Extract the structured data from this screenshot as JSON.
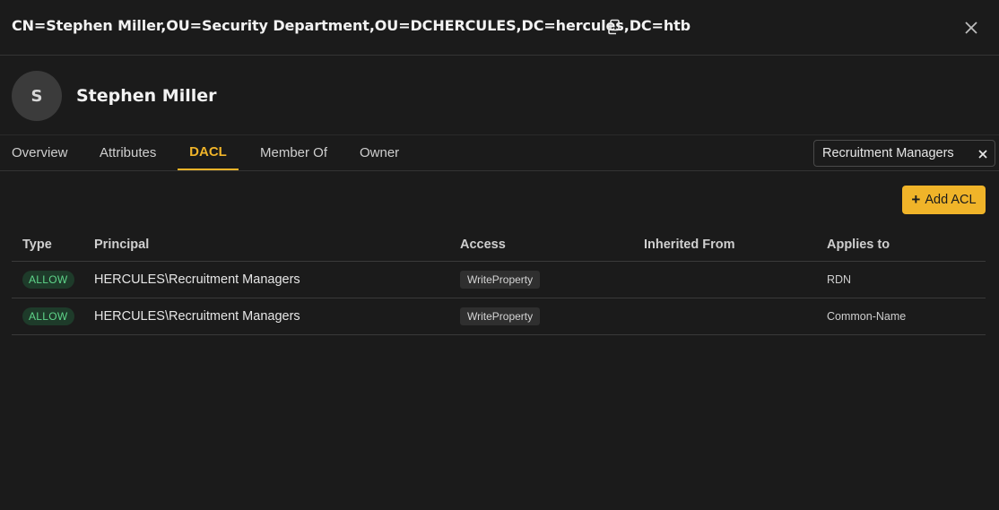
{
  "dialog": {
    "title": "CN=Stephen Miller,OU=Security Department,OU=DCHERCULES,DC=hercules,DC=htb",
    "copy_icon": "copy-icon",
    "close_icon": "close-icon"
  },
  "profile": {
    "avatar_initial": "S",
    "name": "Stephen Miller"
  },
  "tabs": [
    {
      "label": "Overview"
    },
    {
      "label": "Attributes"
    },
    {
      "label": "DACL",
      "active": true
    },
    {
      "label": "Member Of"
    },
    {
      "label": "Owner"
    }
  ],
  "filter": {
    "value": "Recruitment Managers",
    "clear_icon": "close-icon"
  },
  "actions": {
    "add_acl_label": "Add ACL",
    "add_icon": "plus-icon"
  },
  "table": {
    "columns": [
      "Type",
      "Principal",
      "Access",
      "Inherited From",
      "Applies to"
    ],
    "rows": [
      {
        "type": "ALLOW",
        "principal": "HERCULES\\Recruitment Managers",
        "access": "WriteProperty",
        "inherited_from": "",
        "applies_to": "RDN"
      },
      {
        "type": "ALLOW",
        "principal": "HERCULES\\Recruitment Managers",
        "access": "WriteProperty",
        "inherited_from": "",
        "applies_to": "Common-Name"
      }
    ]
  },
  "colors": {
    "background": "#1b1b1b",
    "accent": "#f0b429",
    "allow_text": "#5fd58a",
    "allow_bg": "#1e3b2a"
  }
}
